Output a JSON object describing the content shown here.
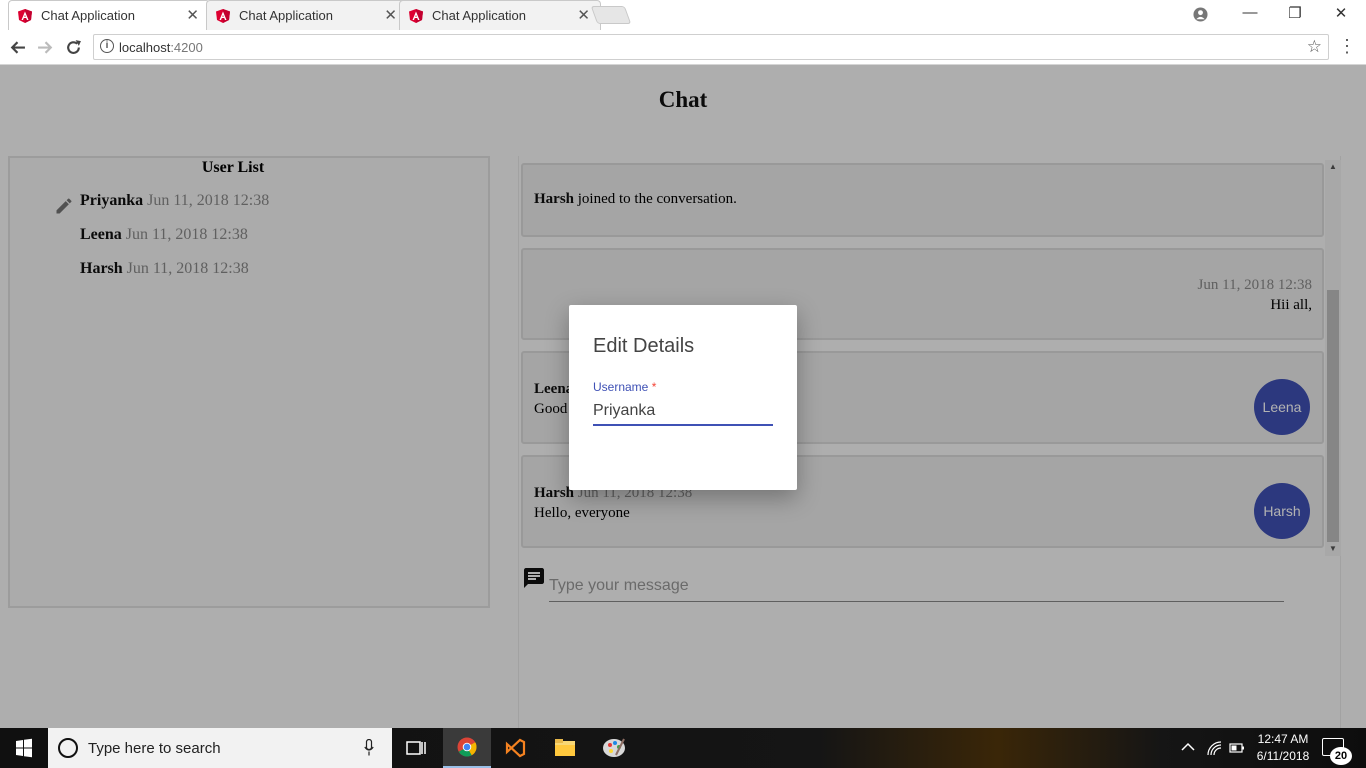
{
  "browser": {
    "tabs": [
      {
        "title": "Chat Application",
        "close": "✕"
      },
      {
        "title": "Chat Application",
        "close": "✕"
      },
      {
        "title": "Chat Application",
        "close": "✕"
      }
    ],
    "url_host": "localhost",
    "url_port": ":4200",
    "window_controls": {
      "minimize": "—",
      "restore": "❐",
      "close": "✕"
    }
  },
  "page": {
    "title": "Chat",
    "user_list": {
      "title": "User List",
      "users": [
        {
          "name": "Priyanka",
          "timestamp": "Jun 11, 2018 12:38"
        },
        {
          "name": "Leena",
          "timestamp": "Jun 11, 2018 12:38"
        },
        {
          "name": "Harsh",
          "timestamp": "Jun 11, 2018 12:38"
        }
      ]
    },
    "messages": [
      {
        "type": "system",
        "name": "Harsh",
        "text": "joined to the conversation."
      },
      {
        "type": "own",
        "timestamp": "Jun 11, 2018 12:38",
        "text": "Hii all,"
      },
      {
        "type": "other",
        "name": "Leena",
        "text": "Good",
        "avatar": "Leena"
      },
      {
        "type": "other",
        "name": "Harsh",
        "timestamp": "Jun 11, 2018 12:38",
        "text": "Hello, everyone",
        "avatar": "Harsh"
      }
    ],
    "composer": {
      "placeholder": "Type your message"
    }
  },
  "dialog": {
    "title": "Edit Details",
    "field_label": "Username",
    "required_mark": "*",
    "field_value": "Priyanka"
  },
  "taskbar": {
    "search_placeholder": "Type here to search",
    "time": "12:47 AM",
    "date": "6/11/2018",
    "notification_count": "20"
  },
  "colors": {
    "accent": "#3f51b5",
    "required": "#f44336"
  },
  "icons": [
    "angular-favicon",
    "back-arrow-icon",
    "forward-arrow-icon",
    "reload-icon",
    "info-icon",
    "star-icon",
    "menu-dots-icon",
    "edit-pencil-icon",
    "chat-bubble-icon",
    "windows-start-icon",
    "cortana-icon",
    "mic-icon",
    "task-view-icon",
    "chrome-icon",
    "visual-studio-icon",
    "file-explorer-icon",
    "paint-icon"
  ]
}
